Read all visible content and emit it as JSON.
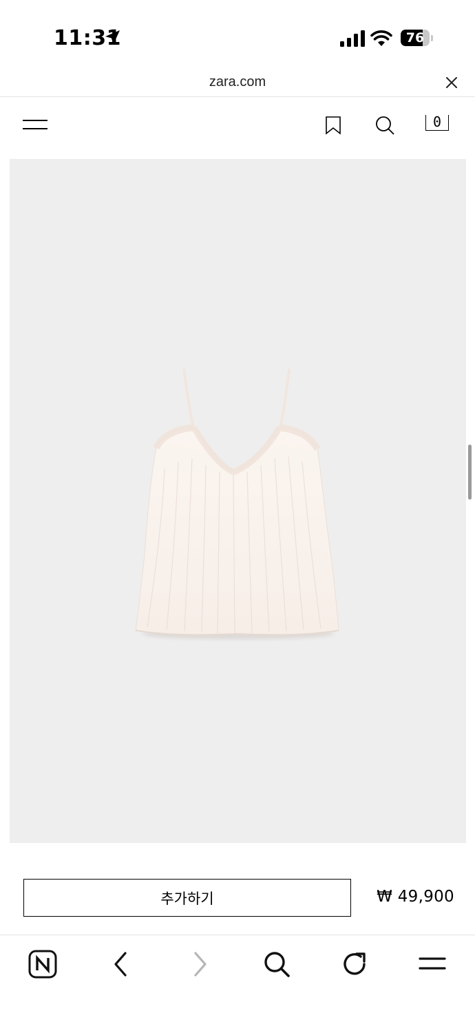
{
  "status_bar": {
    "time": "11:31",
    "battery": "76",
    "battery_level": 0.76,
    "icons": [
      "location-arrow-icon",
      "cellular-signal-icon",
      "wifi-icon",
      "battery-icon"
    ]
  },
  "browser": {
    "url": "zara.com",
    "icons": [
      "close-icon"
    ]
  },
  "header": {
    "icons": [
      "hamburger-menu-icon",
      "bookmark-icon",
      "search-icon",
      "shopping-bag-icon"
    ],
    "cart_count": "0"
  },
  "product": {
    "image": "cream-pleated-camisole-top",
    "background_color": "#efeeee",
    "add_label": "추가하기",
    "price": "₩ 49,900"
  },
  "toolbar": {
    "icons": [
      "naver-home-icon",
      "back-arrow-icon",
      "forward-arrow-icon",
      "search-icon",
      "reload-icon",
      "menu-icon"
    ]
  }
}
